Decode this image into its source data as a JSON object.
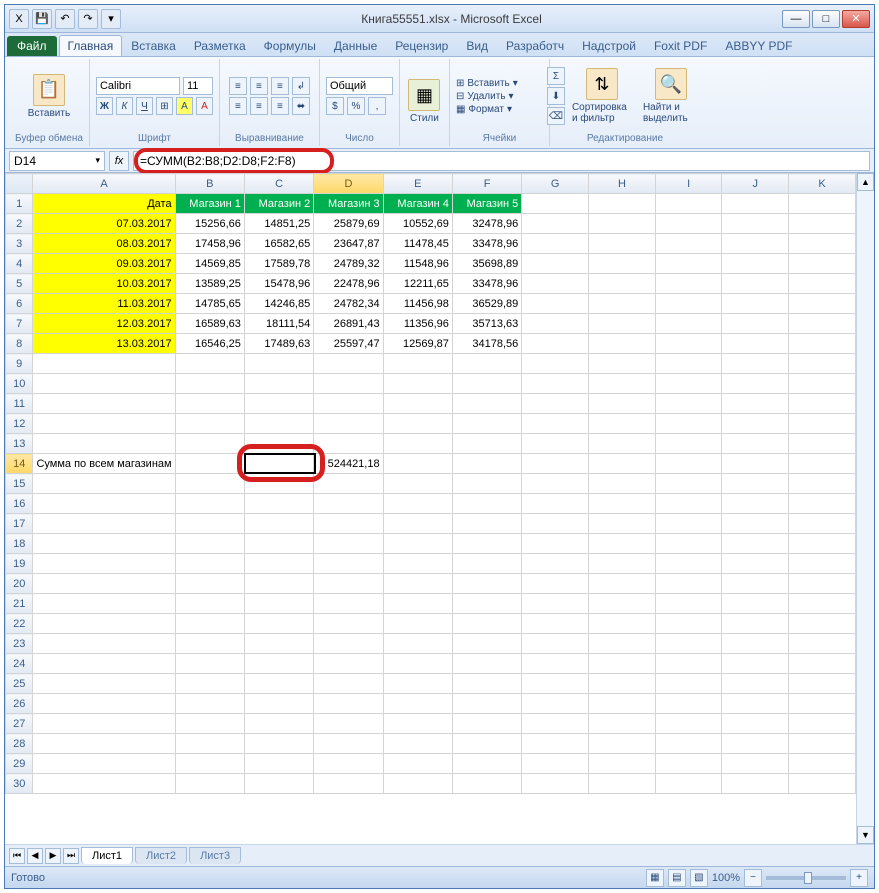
{
  "window": {
    "title": "Книга55551.xlsx - Microsoft Excel"
  },
  "tabs": {
    "file": "Файл",
    "items": [
      "Главная",
      "Вставка",
      "Разметка",
      "Формулы",
      "Данные",
      "Рецензир",
      "Вид",
      "Разработч",
      "Надстрой",
      "Foxit PDF",
      "ABBYY PDF"
    ],
    "active": 0
  },
  "ribbon": {
    "clipboard": {
      "label": "Буфер обмена",
      "paste": "Вставить"
    },
    "font": {
      "label": "Шрифт",
      "name": "Calibri",
      "size": "11"
    },
    "alignment": {
      "label": "Выравнивание"
    },
    "number": {
      "label": "Число",
      "format": "Общий"
    },
    "styles": {
      "label": "Стили",
      "btn": "Стили"
    },
    "cells": {
      "label": "Ячейки",
      "insert": "Вставить",
      "delete": "Удалить",
      "format": "Формат"
    },
    "editing": {
      "label": "Редактирование",
      "sort": "Сортировка и фильтр",
      "find": "Найти и выделить"
    }
  },
  "namebox": "D14",
  "formula": "=СУММ(B2:B8;D2:D8;F2:F8)",
  "columns": [
    "A",
    "B",
    "C",
    "D",
    "E",
    "F",
    "G",
    "H",
    "I",
    "J",
    "K"
  ],
  "rows": [
    "1",
    "2",
    "3",
    "4",
    "5",
    "6",
    "7",
    "8",
    "9",
    "10",
    "11",
    "12",
    "13",
    "14",
    "15",
    "16",
    "17",
    "18",
    "19",
    "20",
    "21",
    "22",
    "23",
    "24",
    "25",
    "26",
    "27",
    "28",
    "29",
    "30"
  ],
  "headers": [
    "Дата",
    "Магазин 1",
    "Магазин 2",
    "Магазин 3",
    "Магазин 4",
    "Магазин 5"
  ],
  "data": [
    [
      "07.03.2017",
      "15256,66",
      "14851,25",
      "25879,69",
      "10552,69",
      "32478,96"
    ],
    [
      "08.03.2017",
      "17458,96",
      "16582,65",
      "23647,87",
      "11478,45",
      "33478,96"
    ],
    [
      "09.03.2017",
      "14569,85",
      "17589,78",
      "24789,32",
      "11548,96",
      "35698,89"
    ],
    [
      "10.03.2017",
      "13589,25",
      "15478,96",
      "22478,96",
      "12211,65",
      "33478,96"
    ],
    [
      "11.03.2017",
      "14785,65",
      "14246,85",
      "24782,34",
      "11456,98",
      "36529,89"
    ],
    [
      "12.03.2017",
      "16589,63",
      "18111,54",
      "26891,43",
      "11356,96",
      "35713,63"
    ],
    [
      "13.03.2017",
      "16546,25",
      "17489,63",
      "25597,47",
      "12569,87",
      "34178,56"
    ]
  ],
  "sum_label": "Сумма по всем магазинам",
  "sum_value": "524421,18",
  "sheets": {
    "active": "Лист1",
    "others": [
      "Лист2",
      "Лист3"
    ]
  },
  "status": "Готово",
  "zoom": "100%"
}
